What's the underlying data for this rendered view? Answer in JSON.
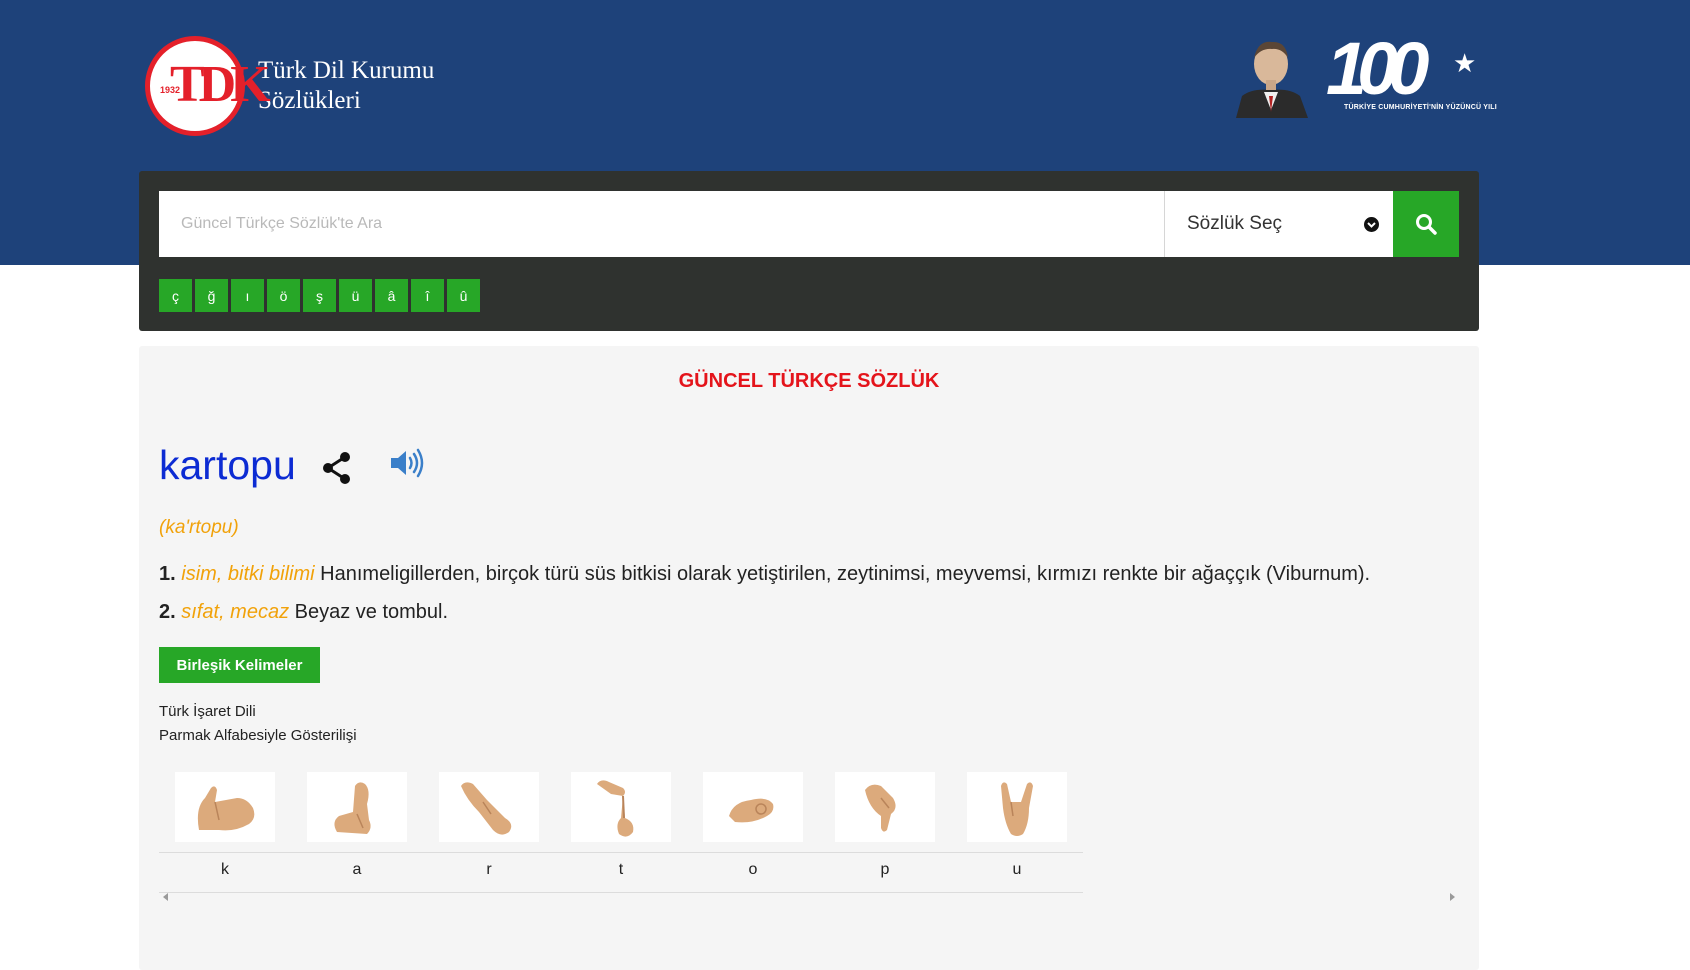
{
  "header": {
    "logo": {
      "year": "1932",
      "monogram": "TDK",
      "line1": "Türk Dil Kurumu",
      "line2": "Sözlükleri"
    },
    "anniversary": {
      "number": "100",
      "caption": "TÜRKİYE CUMHURİYETİ'NİN YÜZÜNCÜ YILI"
    }
  },
  "search": {
    "placeholder": "Güncel Türkçe Sözlük'te Ara",
    "value": "",
    "dictionary_select": "Sözlük Seç",
    "special_chars": [
      "ç",
      "ğ",
      "ı",
      "ö",
      "ş",
      "ü",
      "â",
      "î",
      "û"
    ]
  },
  "entry": {
    "dictionary_title": "GÜNCEL TÜRKÇE SÖZLÜK",
    "headword": "kartopu",
    "pronunciation": "(ka'rtopu)",
    "meanings": [
      {
        "num": "1.",
        "tags": "isim, bitki bilimi",
        "text": "Hanımeligillerden, birçok türü süs bitkisi olarak yetiştirilen, zeytinimsi, meyvemsi, kırmızı renkte bir ağaççık (Viburnum)."
      },
      {
        "num": "2.",
        "tags": "sıfat, mecaz",
        "text": "Beyaz ve tombul."
      }
    ],
    "compound_button": "Birleşik Kelimeler",
    "sign_language": {
      "label1": "Türk İşaret Dili",
      "label2": "Parmak Alfabesiyle Gösterilişi",
      "letters": [
        "k",
        "a",
        "r",
        "t",
        "o",
        "p",
        "u"
      ]
    }
  },
  "colors": {
    "header_bg": "#1e427a",
    "panel_bg": "#2f322f",
    "accent_green": "#27a727",
    "title_red": "#e4141b",
    "headword_blue": "#0c2bd3",
    "tag_orange": "#f1a20a",
    "skin": "#dcaa7c"
  }
}
